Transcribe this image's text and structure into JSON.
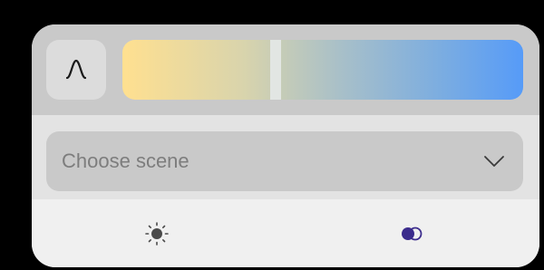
{
  "controls": {
    "curve_button_icon": "curve-icon",
    "temperature_slider": {
      "value": 0.38,
      "colors": [
        "#ffe090",
        "#569bf8"
      ]
    }
  },
  "scene": {
    "label": "Choose scene",
    "chevron_icon": "chevron-down-icon"
  },
  "tabs": [
    {
      "icon": "brightness-icon",
      "selected": false
    },
    {
      "icon": "color-mix-icon",
      "selected": true
    }
  ],
  "colors": {
    "accent": "#3b2c8c",
    "panel": "#c9c9c9",
    "card": "#f0f0f0"
  }
}
